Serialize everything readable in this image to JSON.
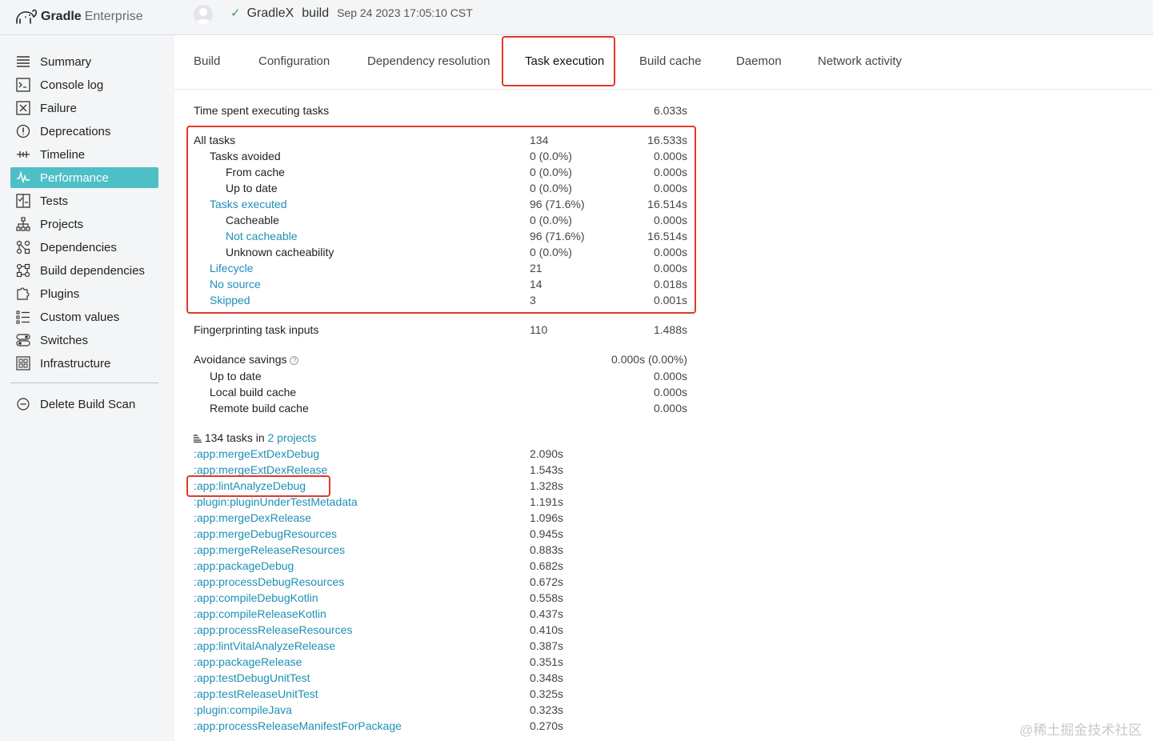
{
  "app": {
    "brand_bold": "Gradle",
    "brand_light": "Enterprise"
  },
  "build": {
    "project": "GradleX",
    "task": "build",
    "date": "Sep 24 2023 17:05:10 CST"
  },
  "sidebar": {
    "items": [
      {
        "label": "Summary",
        "icon": "list-icon"
      },
      {
        "label": "Console log",
        "icon": "console-icon"
      },
      {
        "label": "Failure",
        "icon": "failure-icon"
      },
      {
        "label": "Deprecations",
        "icon": "warning-icon"
      },
      {
        "label": "Timeline",
        "icon": "timeline-icon"
      },
      {
        "label": "Performance",
        "icon": "performance-icon"
      },
      {
        "label": "Tests",
        "icon": "tests-icon"
      },
      {
        "label": "Projects",
        "icon": "projects-icon"
      },
      {
        "label": "Dependencies",
        "icon": "dependencies-icon"
      },
      {
        "label": "Build dependencies",
        "icon": "build-dependencies-icon"
      },
      {
        "label": "Plugins",
        "icon": "plugin-icon"
      },
      {
        "label": "Custom values",
        "icon": "custom-values-icon"
      },
      {
        "label": "Switches",
        "icon": "switches-icon"
      },
      {
        "label": "Infrastructure",
        "icon": "infrastructure-icon"
      }
    ],
    "active": "Performance",
    "delete_label": "Delete Build Scan"
  },
  "tabs": [
    "Build",
    "Configuration",
    "Dependency resolution",
    "Task execution",
    "Build cache",
    "Daemon",
    "Network activity"
  ],
  "active_tab": "Task execution",
  "summary": {
    "time_label": "Time spent executing tasks",
    "time_value": "6.033s",
    "breakdown": [
      {
        "label": "All tasks",
        "count": "134",
        "time": "16.533s",
        "indent": 0,
        "link": false
      },
      {
        "label": "Tasks avoided",
        "count": "0 (0.0%)",
        "time": "0.000s",
        "indent": 1,
        "link": false
      },
      {
        "label": "From cache",
        "count": "0 (0.0%)",
        "time": "0.000s",
        "indent": 2,
        "link": false
      },
      {
        "label": "Up to date",
        "count": "0 (0.0%)",
        "time": "0.000s",
        "indent": 2,
        "link": false
      },
      {
        "label": "Tasks executed",
        "count": "96 (71.6%)",
        "time": "16.514s",
        "indent": 1,
        "link": true
      },
      {
        "label": "Cacheable",
        "count": "0 (0.0%)",
        "time": "0.000s",
        "indent": 2,
        "link": false
      },
      {
        "label": "Not cacheable",
        "count": "96 (71.6%)",
        "time": "16.514s",
        "indent": 2,
        "link": true
      },
      {
        "label": "Unknown cacheability",
        "count": "0 (0.0%)",
        "time": "0.000s",
        "indent": 2,
        "link": false
      },
      {
        "label": "Lifecycle",
        "count": "21",
        "time": "0.000s",
        "indent": 1,
        "link": true
      },
      {
        "label": "No source",
        "count": "14",
        "time": "0.018s",
        "indent": 1,
        "link": true
      },
      {
        "label": "Skipped",
        "count": "3",
        "time": "0.001s",
        "indent": 1,
        "link": true
      }
    ],
    "fingerprint_label": "Fingerprinting task inputs",
    "fingerprint_count": "110",
    "fingerprint_time": "1.488s",
    "avoidance_label": "Avoidance savings",
    "avoidance_value": "0.000s (0.00%)",
    "avoidance_items": [
      {
        "label": "Up to date",
        "time": "0.000s"
      },
      {
        "label": "Local build cache",
        "time": "0.000s"
      },
      {
        "label": "Remote build cache",
        "time": "0.000s"
      }
    ]
  },
  "tasks_header": {
    "count_text": "134 tasks in",
    "projects_link": "2 projects"
  },
  "tasks": [
    {
      "name": ":app:mergeExtDexDebug",
      "time": "2.090s"
    },
    {
      "name": ":app:mergeExtDexRelease",
      "time": "1.543s"
    },
    {
      "name": ":app:lintAnalyzeDebug",
      "time": "1.328s"
    },
    {
      "name": ":plugin:pluginUnderTestMetadata",
      "time": "1.191s"
    },
    {
      "name": ":app:mergeDexRelease",
      "time": "1.096s"
    },
    {
      "name": ":app:mergeDebugResources",
      "time": "0.945s"
    },
    {
      "name": ":app:mergeReleaseResources",
      "time": "0.883s"
    },
    {
      "name": ":app:packageDebug",
      "time": "0.682s"
    },
    {
      "name": ":app:processDebugResources",
      "time": "0.672s"
    },
    {
      "name": ":app:compileDebugKotlin",
      "time": "0.558s"
    },
    {
      "name": ":app:compileReleaseKotlin",
      "time": "0.437s"
    },
    {
      "name": ":app:processReleaseResources",
      "time": "0.410s"
    },
    {
      "name": ":app:lintVitalAnalyzeRelease",
      "time": "0.387s"
    },
    {
      "name": ":app:packageRelease",
      "time": "0.351s"
    },
    {
      "name": ":app:testDebugUnitTest",
      "time": "0.348s"
    },
    {
      "name": ":app:testReleaseUnitTest",
      "time": "0.325s"
    },
    {
      "name": ":plugin:compileJava",
      "time": "0.323s"
    },
    {
      "name": ":app:processReleaseManifestForPackage",
      "time": "0.270s"
    }
  ],
  "watermark": "@稀土掘金技术社区",
  "colors": {
    "accent": "#4dbfc6",
    "link": "#1d8fb5",
    "highlight": "#e0392b",
    "success": "#3b9c5d"
  }
}
